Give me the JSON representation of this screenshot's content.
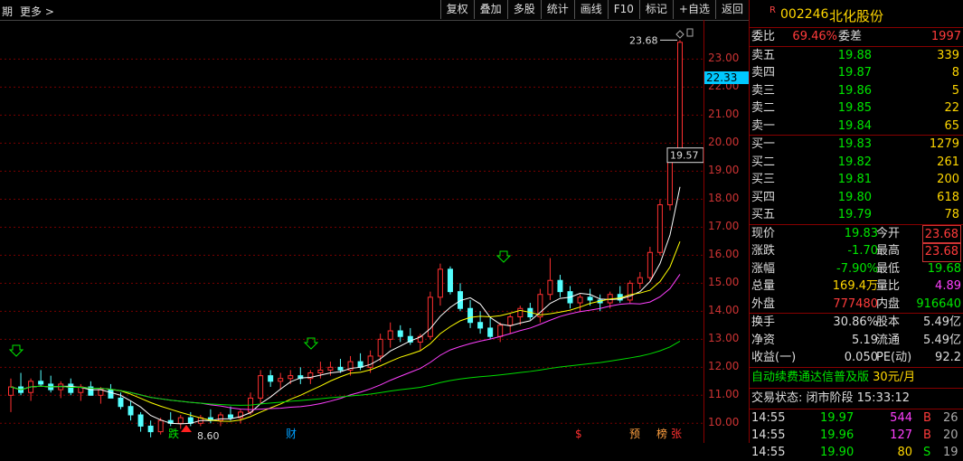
{
  "topbar": {
    "period_label": "期",
    "more_label": "更多 >"
  },
  "toolbar": [
    "复权",
    "叠加",
    "多股",
    "统计",
    "画线",
    "F10",
    "标记",
    "+自选",
    "返回"
  ],
  "stock": {
    "badge": "R",
    "code": "002246",
    "name": "北化股份"
  },
  "weibi": {
    "label1": "委比",
    "value1": "69.46%",
    "label2": "委差",
    "value2": "1997"
  },
  "sell": [
    {
      "label": "卖五",
      "price": "19.88",
      "vol": "339"
    },
    {
      "label": "卖四",
      "price": "19.87",
      "vol": "8"
    },
    {
      "label": "卖三",
      "price": "19.86",
      "vol": "5"
    },
    {
      "label": "卖二",
      "price": "19.85",
      "vol": "22"
    },
    {
      "label": "卖一",
      "price": "19.84",
      "vol": "65"
    }
  ],
  "buy": [
    {
      "label": "买一",
      "price": "19.83",
      "vol": "1279"
    },
    {
      "label": "买二",
      "price": "19.82",
      "vol": "261"
    },
    {
      "label": "买三",
      "price": "19.81",
      "vol": "200"
    },
    {
      "label": "买四",
      "price": "19.80",
      "vol": "618"
    },
    {
      "label": "买五",
      "price": "19.79",
      "vol": "78"
    }
  ],
  "quote": {
    "xianjia_l": "现价",
    "xianjia": "19.83",
    "jinkai_l": "今开",
    "jinkai": "23.68",
    "zhangdie_l": "涨跌",
    "zhangdie": "-1.70",
    "zuigao_l": "最高",
    "zuigao": "23.68",
    "zhangfu_l": "涨幅",
    "zhangfu": "-7.90%",
    "zuidi_l": "最低",
    "zuidi": "19.68",
    "zongliang_l": "总量",
    "zongliang": "169.4万",
    "liangbi_l": "量比",
    "liangbi": "4.89",
    "waipan_l": "外盘",
    "waipan": "777480",
    "neipan_l": "内盘",
    "neipan": "916640"
  },
  "fund": {
    "huanshou_l": "换手",
    "huanshou": "30.86%",
    "guben_l": "股本",
    "guben": "5.49亿",
    "jingzi_l": "净资",
    "jingzi": "5.19",
    "liutong_l": "流通",
    "liutong": "5.49亿",
    "shouyi_l": "收益(一)",
    "shouyi": "0.050",
    "pe_l": "PE(动)",
    "pe": "92.2"
  },
  "promo": {
    "text": "自动续费通达信普及版",
    "price": "30元/月"
  },
  "status": {
    "text": "交易状态: 闭市阶段 15:33:12"
  },
  "ticks": [
    {
      "time": "14:55",
      "price": "19.97",
      "vol": "544",
      "side": "B",
      "num": "26"
    },
    {
      "time": "14:55",
      "price": "19.96",
      "vol": "127",
      "side": "B",
      "num": "20"
    },
    {
      "time": "14:55",
      "price": "19.90",
      "vol": "80",
      "side": "S",
      "num": "19"
    }
  ],
  "chart_data": {
    "type": "candlestick",
    "ylim": [
      9.3,
      24.4
    ],
    "price_ticks": [
      "23.00",
      "22.00",
      "21.00",
      "20.00",
      "19.00",
      "18.00",
      "17.00",
      "16.00",
      "15.00",
      "14.00",
      "13.00",
      "12.00",
      "11.00",
      "10.00"
    ],
    "price_tick_values": [
      23,
      22,
      21,
      20,
      19,
      18,
      17,
      16,
      15,
      14,
      13,
      12,
      11,
      10
    ],
    "current_price_label": "22.33",
    "current_price": 22.33,
    "high_annotation": "23.68",
    "low_annotation": "8.60",
    "close_annotation": "19.57",
    "markers": {
      "die": "跌",
      "cai": "财",
      "dollar": "$",
      "yu": "预",
      "bang": "榜",
      "zhang": "张"
    },
    "candles": [
      [
        11.0,
        11.6,
        10.4,
        11.3
      ],
      [
        11.3,
        11.8,
        11.0,
        11.1
      ],
      [
        11.1,
        11.6,
        10.8,
        11.5
      ],
      [
        11.5,
        11.9,
        11.3,
        11.4
      ],
      [
        11.4,
        11.7,
        11.1,
        11.2
      ],
      [
        11.2,
        11.5,
        10.9,
        11.4
      ],
      [
        11.4,
        11.6,
        11.0,
        11.1
      ],
      [
        11.1,
        11.4,
        10.8,
        11.3
      ],
      [
        11.3,
        11.5,
        11.0,
        11.0
      ],
      [
        11.0,
        11.3,
        10.7,
        11.2
      ],
      [
        11.2,
        11.4,
        10.9,
        10.9
      ],
      [
        10.9,
        11.1,
        10.5,
        10.6
      ],
      [
        10.6,
        10.8,
        10.1,
        10.3
      ],
      [
        10.3,
        10.4,
        9.7,
        9.9
      ],
      [
        9.9,
        10.1,
        9.5,
        9.7
      ],
      [
        9.7,
        10.2,
        9.6,
        10.1
      ],
      [
        10.1,
        10.4,
        9.9,
        10.0
      ],
      [
        10.0,
        10.3,
        9.8,
        10.2
      ],
      [
        10.2,
        10.4,
        9.9,
        10.0
      ],
      [
        10.0,
        10.3,
        9.9,
        10.2
      ],
      [
        10.2,
        10.5,
        10.0,
        10.1
      ],
      [
        10.1,
        10.4,
        9.9,
        10.3
      ],
      [
        10.3,
        10.6,
        10.1,
        10.2
      ],
      [
        10.2,
        10.5,
        10.0,
        10.4
      ],
      [
        10.4,
        11.1,
        10.3,
        10.9
      ],
      [
        10.9,
        11.9,
        10.7,
        11.7
      ],
      [
        11.7,
        11.9,
        11.3,
        11.5
      ],
      [
        11.5,
        11.8,
        11.2,
        11.6
      ],
      [
        11.6,
        11.9,
        11.4,
        11.7
      ],
      [
        11.7,
        12.0,
        11.4,
        11.6
      ],
      [
        11.6,
        11.9,
        11.4,
        11.8
      ],
      [
        11.8,
        12.2,
        11.6,
        11.9
      ],
      [
        11.9,
        12.2,
        11.7,
        12.0
      ],
      [
        12.0,
        12.3,
        11.8,
        11.9
      ],
      [
        11.9,
        12.4,
        11.7,
        12.2
      ],
      [
        12.2,
        12.5,
        11.9,
        12.0
      ],
      [
        12.0,
        12.6,
        11.8,
        12.4
      ],
      [
        12.4,
        13.2,
        12.2,
        13.0
      ],
      [
        13.0,
        13.6,
        12.7,
        13.3
      ],
      [
        13.3,
        13.5,
        12.9,
        13.1
      ],
      [
        13.1,
        13.4,
        12.8,
        12.9
      ],
      [
        12.9,
        13.2,
        12.6,
        13.1
      ],
      [
        13.1,
        14.7,
        13.0,
        14.5
      ],
      [
        14.5,
        15.7,
        14.2,
        15.5
      ],
      [
        15.5,
        15.6,
        14.6,
        14.7
      ],
      [
        14.7,
        15.0,
        14.0,
        14.1
      ],
      [
        14.1,
        14.4,
        13.4,
        13.6
      ],
      [
        13.6,
        14.0,
        13.2,
        13.4
      ],
      [
        13.4,
        13.8,
        13.0,
        13.1
      ],
      [
        13.1,
        13.6,
        12.9,
        13.5
      ],
      [
        13.5,
        13.9,
        13.2,
        13.8
      ],
      [
        13.8,
        14.2,
        13.5,
        14.1
      ],
      [
        14.1,
        14.3,
        13.7,
        13.8
      ],
      [
        13.8,
        14.8,
        13.6,
        14.6
      ],
      [
        14.6,
        15.9,
        14.4,
        15.1
      ],
      [
        15.1,
        15.3,
        14.5,
        14.7
      ],
      [
        14.7,
        14.9,
        14.1,
        14.3
      ],
      [
        14.3,
        14.6,
        14.0,
        14.5
      ],
      [
        14.5,
        14.8,
        14.2,
        14.4
      ],
      [
        14.4,
        14.6,
        14.0,
        14.3
      ],
      [
        14.3,
        14.7,
        14.1,
        14.6
      ],
      [
        14.6,
        14.9,
        14.3,
        14.4
      ],
      [
        14.4,
        15.1,
        14.3,
        15.0
      ],
      [
        15.0,
        15.4,
        14.8,
        15.2
      ],
      [
        15.2,
        16.3,
        15.1,
        16.1
      ],
      [
        16.1,
        18.0,
        16.0,
        17.8
      ],
      [
        17.8,
        19.6,
        17.6,
        19.5
      ],
      [
        19.6,
        23.68,
        19.5,
        23.6
      ]
    ]
  }
}
